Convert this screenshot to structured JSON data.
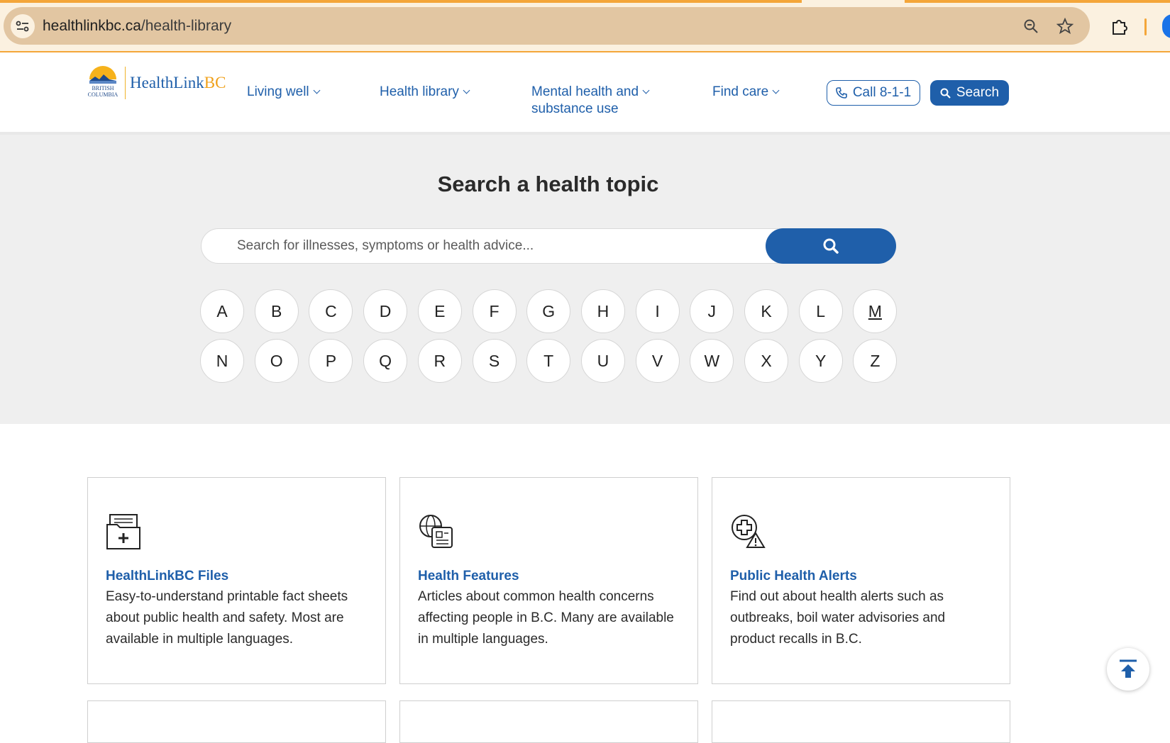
{
  "browser": {
    "url_domain": "healthlinkbc.ca",
    "url_path": "/health-library",
    "icons": [
      "site-info-icon",
      "zoom-icon",
      "bookmark-star-icon",
      "extensions-icon"
    ]
  },
  "header": {
    "logo_text": "HealthLink",
    "logo_text_bc": "BC",
    "logo_mark_text": "BRITISH COLUMBIA",
    "nav": [
      {
        "label": "Living well"
      },
      {
        "label": "Health library"
      },
      {
        "label": "Mental health and"
      },
      {
        "label": "substance use"
      },
      {
        "label": "Find care"
      }
    ],
    "call_label": "Call 8-1-1",
    "search_label": "Search"
  },
  "search": {
    "title": "Search a health topic",
    "placeholder": "Search for illnesses, symptoms or health advice...",
    "letters_row1": [
      "A",
      "B",
      "C",
      "D",
      "E",
      "F",
      "G",
      "H",
      "I",
      "J",
      "K",
      "L",
      "M"
    ],
    "letters_row2": [
      "N",
      "O",
      "P",
      "Q",
      "R",
      "S",
      "T",
      "U",
      "V",
      "W",
      "X",
      "Y",
      "Z"
    ],
    "active_letter": "M"
  },
  "cards": [
    {
      "title": "HealthLinkBC Files",
      "desc": "Easy-to-understand printable fact sheets about public health and safety. Most are available in multiple languages.",
      "icon": "file-plus-icon"
    },
    {
      "title": "Health Features",
      "desc": "Articles about common health concerns affecting people in B.C. Many are available in multiple languages.",
      "icon": "globe-document-icon"
    },
    {
      "title": "Public Health Alerts",
      "desc": "Find out about health alerts such as outbreaks, boil water advisories and product recalls in B.C.",
      "icon": "health-alert-icon"
    }
  ],
  "colors": {
    "brand_blue": "#1f5faa",
    "brand_gold": "#f0a019",
    "band_gray": "#efefef",
    "chrome_accent": "#f4a63a"
  }
}
